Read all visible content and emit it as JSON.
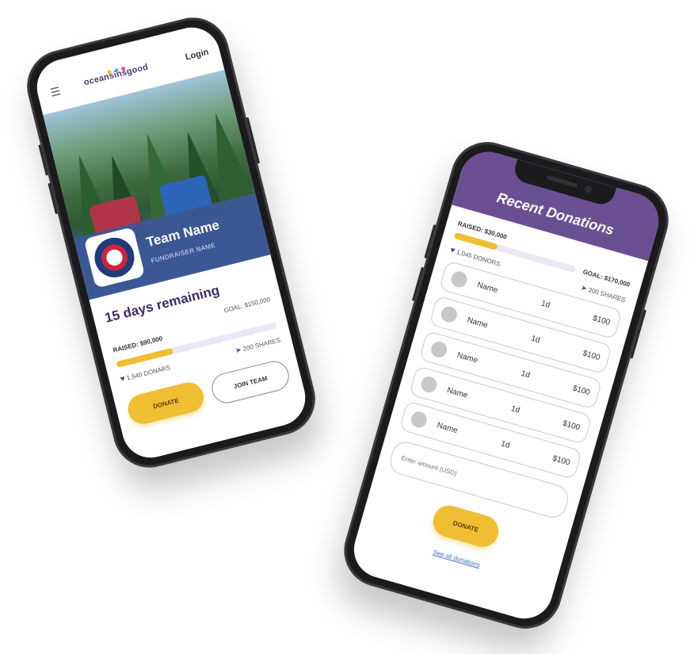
{
  "colors": {
    "brand_purple": "#6a4f93",
    "accent_yellow": "#f0be32",
    "progress_track": "#ece7f8",
    "link_blue": "#3b6fc9"
  },
  "phone1": {
    "header": {
      "menu_icon": "hamburger-menu-icon",
      "logo_text": "oceansinsgood",
      "login_label": "Login"
    },
    "hero": {
      "team_name": "Team Name",
      "fundraiser_name": "FUNDRAISER NAME"
    },
    "campaign": {
      "days_remaining": "15 days remaining",
      "goal_label": "GOAL: $150,000",
      "raised_label": "RAISED: $90,000",
      "progress": 0.35,
      "donors_label": "1,540 DONARS",
      "shares_label": "200 SHARES"
    },
    "buttons": {
      "donate_label": "DONATE",
      "join_label": "JOIN TEAM"
    }
  },
  "phone2": {
    "header": {
      "title": "Recent Donations"
    },
    "summary": {
      "raised_label": "RAISED: $30,000",
      "goal_label": "GOAL: $170,000",
      "progress": 0.35,
      "donors_label": "1,045 DONORS",
      "shares_label": "200 SHARES"
    },
    "donations": [
      {
        "name": "Name",
        "time": "1d",
        "amount": "$100"
      },
      {
        "name": "Name",
        "time": "1d",
        "amount": "$100"
      },
      {
        "name": "Name",
        "time": "1d",
        "amount": "$100"
      },
      {
        "name": "Name",
        "time": "1d",
        "amount": "$100"
      },
      {
        "name": "Name",
        "time": "1d",
        "amount": "$100"
      }
    ],
    "amount_input": {
      "placeholder": "Enter amount (USD)"
    },
    "donate_label": "DONATE",
    "see_all_label": "See all donations"
  }
}
